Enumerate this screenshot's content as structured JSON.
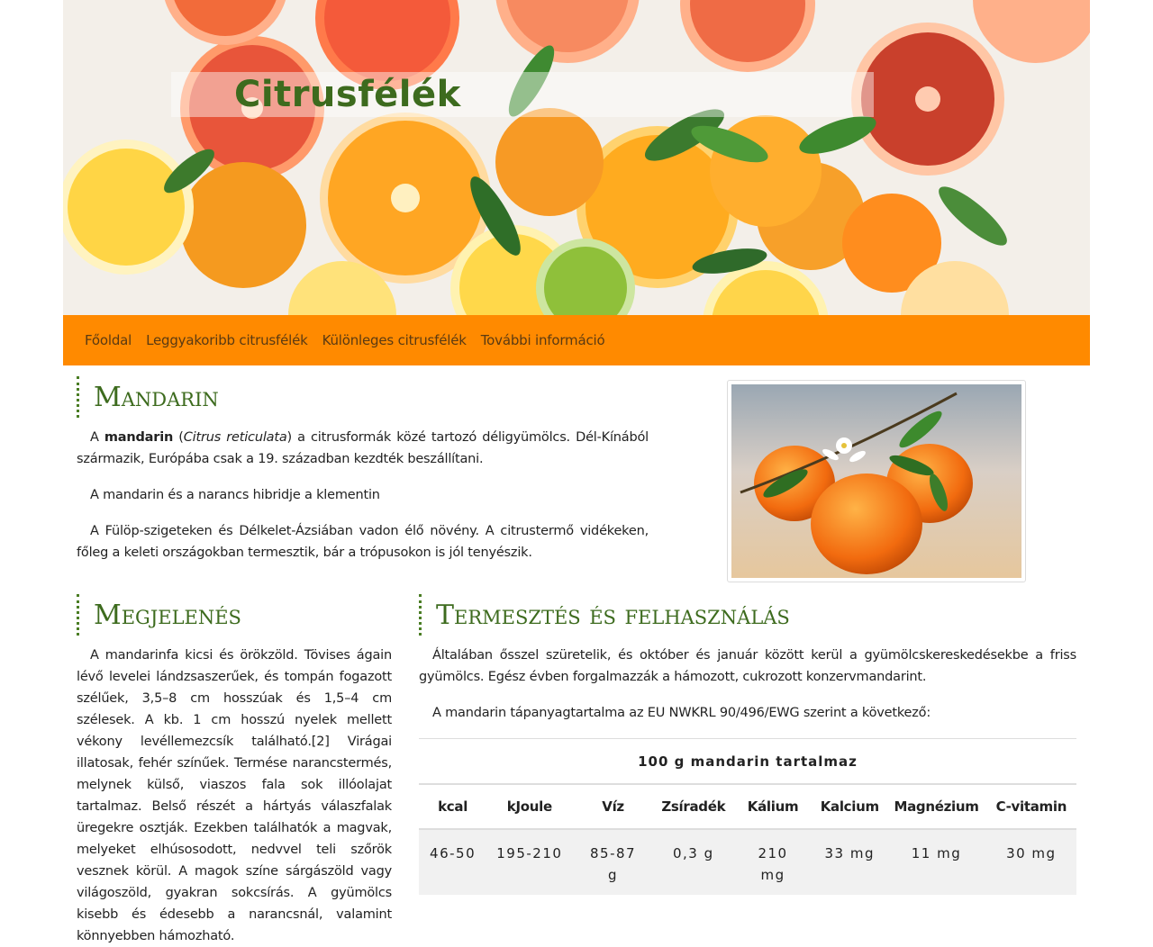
{
  "site": {
    "title": "Citrusfélék"
  },
  "nav": {
    "items": [
      {
        "label": "Főoldal"
      },
      {
        "label": "Leggyakoribb citrusfélék"
      },
      {
        "label": "Különleges citrusfélék"
      },
      {
        "label": "További információ"
      }
    ]
  },
  "mandarin": {
    "heading": "Mandarin",
    "p1": {
      "pre": "A ",
      "bold": "mandarin",
      "mid1": " (",
      "italic": "Citrus reticulata",
      "post": ") a citrusformák közé tartozó déligyümölcs. Dél-Kínából származik, Európába csak a 19. században kezdték beszállítani."
    },
    "p2": "A mandarin és a narancs hibridje a klementin",
    "p3": "A Fülöp-szigeteken és Délkelet-Ázsiában vadon élő növény. A citrustermő vidékeken, főleg a keleti országokban termesztik, bár a trópusokon is jól tenyészik."
  },
  "megjelenes": {
    "heading": "Megjelenés",
    "p1": "A mandarinfa kicsi és örökzöld. Tövises ágain lévő levelei lándzsaszerűek, és tompán fogazott szélűek, 3,5–8 cm hosszúak és 1,5–4 cm szélesek. A kb. 1 cm hosszú nyelek mellett vékony levéllemezcsík található.[2] Virágai illatosak, fehér színűek. Termése narancstermés, melynek külső, viaszos fala sok illóolajat tartalmaz. Belső részét a hártyás válaszfalak üregekre osztják. Ezekben találhatók a magvak, melyeket elhúsosodott, nedvvel teli szőrök vesznek körül. A magok színe sárgászöld vagy világoszöld, gyakran sokcsírás. A gyümölcs kisebb és édesebb a narancsnál, valamint könnyebben hámozható."
  },
  "termesztes": {
    "heading": "Termesztés és felhasználás",
    "p1": "Általában ősszel szüretelik, és október és január között kerül a gyümölcskereskedésekbe a friss gyümölcs. Egész évben forgalmazzák a hámozott, cukrozott konzervmandarint.",
    "p2": "A mandarin tápanyagtartalma az EU NWKRL 90/496/EWG szerint a következő:",
    "table": {
      "caption": "100 g mandarin tartalmaz",
      "headers": [
        "kcal",
        "kJoule",
        "Víz",
        "Zsíradék",
        "Kálium",
        "Kalcium",
        "Magnézium",
        "C-vitamin"
      ],
      "row": [
        "46-50",
        "195-210",
        "85-87 g",
        "0,3 g",
        "210 mg",
        "33 mg",
        "11 mg",
        "30 mg"
      ]
    }
  },
  "colors": {
    "accent_green": "#3d6b1e",
    "nav_orange": "#ff8a00",
    "nav_text": "#5a3a12"
  }
}
